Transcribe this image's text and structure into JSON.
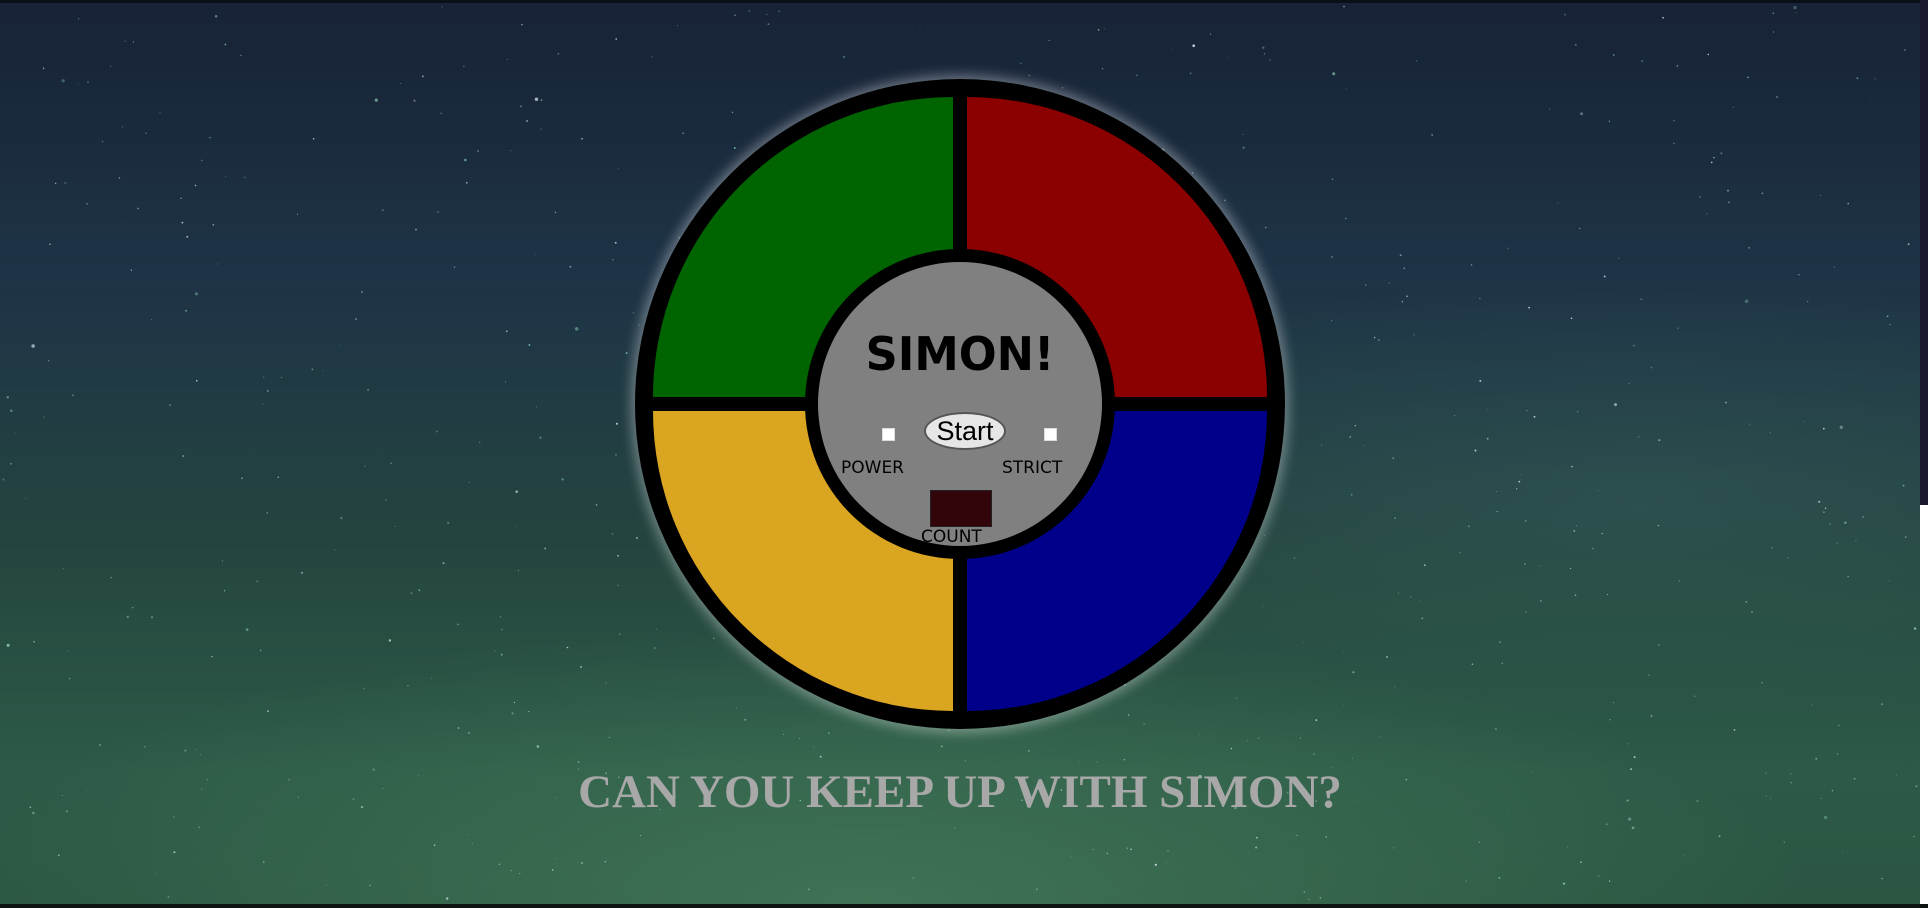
{
  "game": {
    "title": "SIMON!",
    "start_label": "Start",
    "power_label": "POWER",
    "strict_label": "STRICT",
    "count_label": "COUNT",
    "count_value": "",
    "power_on": false,
    "strict_on": false
  },
  "pads": [
    {
      "name": "green",
      "color": "#006400"
    },
    {
      "name": "red",
      "color": "#8b0000"
    },
    {
      "name": "yellow",
      "color": "#daa520"
    },
    {
      "name": "blue",
      "color": "#00008b"
    }
  ],
  "colors": {
    "count_display": "#32050a",
    "tagline": "#a8a8a8",
    "center": "#808080"
  },
  "tagline": "CAN YOU KEEP UP WITH SIMON?"
}
